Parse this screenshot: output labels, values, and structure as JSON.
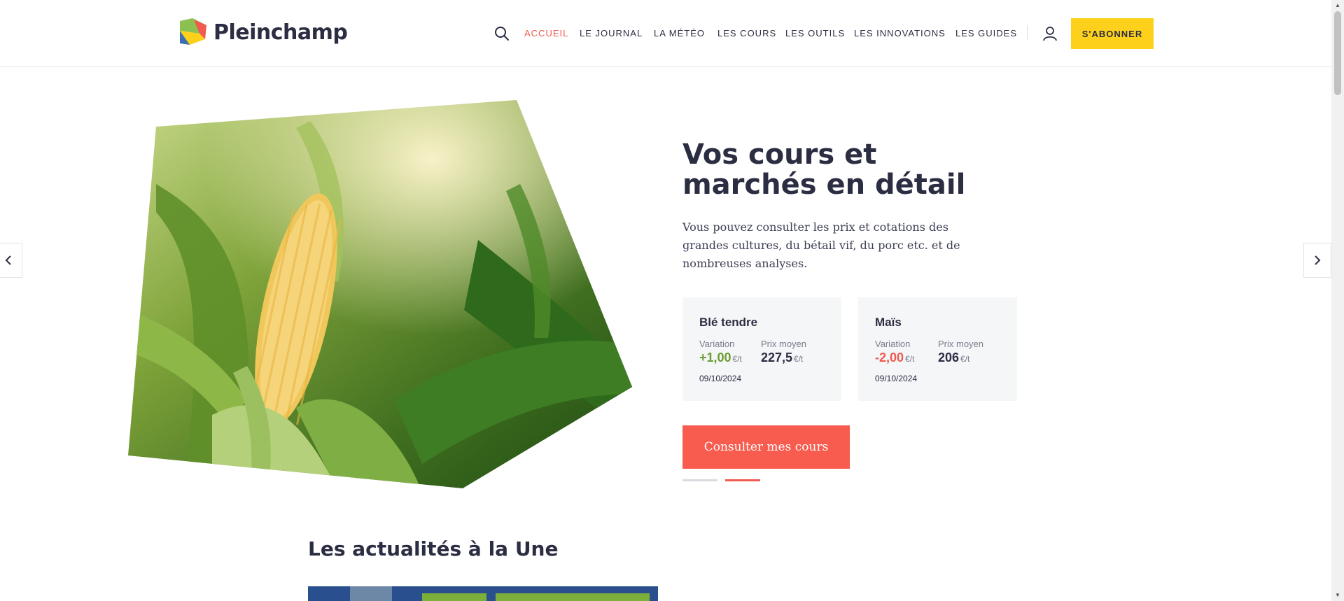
{
  "header": {
    "logo_text": "Pleinchamp",
    "nav": [
      {
        "label": "ACCUEIL",
        "active": true
      },
      {
        "label": "LE JOURNAL",
        "active": false
      },
      {
        "label": "LA MÉTÉO",
        "active": false
      },
      {
        "label": "LES COURS",
        "active": false
      },
      {
        "label": "LES OUTILS",
        "active": false
      },
      {
        "label": "LES INNOVATIONS",
        "active": false
      },
      {
        "label": "LES GUIDES",
        "active": false
      }
    ],
    "subscribe_label": "S'ABONNER",
    "icons": {
      "search": "search-icon",
      "user": "user-icon"
    }
  },
  "hero": {
    "title": "Vos cours et marchés en détail",
    "description": "Vous pouvez consulter les prix et cotations des grandes cultures, du bétail vif, du porc etc. et de nombreuses analyses.",
    "cards": [
      {
        "name": "Blé tendre",
        "variation_label": "Variation",
        "variation_value": "+1,00",
        "variation_unit": "€/t",
        "price_label": "Prix moyen",
        "price_value": "227,5",
        "price_unit": "€/t",
        "date": "09/10/2024"
      },
      {
        "name": "Maïs",
        "variation_label": "Variation",
        "variation_value": "-2,00",
        "variation_unit": "€/t",
        "price_label": "Prix moyen",
        "price_value": "206",
        "price_unit": "€/t",
        "date": "09/10/2024"
      }
    ],
    "cta_label": "Consulter mes cours",
    "slider": {
      "count": 2,
      "active_index": 1
    }
  },
  "news": {
    "section_title": "Les actualités à la Une"
  },
  "colors": {
    "accent": "#f05a4f",
    "cta": "#f75c4f",
    "subscribe": "#fdd11b",
    "positive": "#6a9c30",
    "text": "#2b2d42"
  }
}
